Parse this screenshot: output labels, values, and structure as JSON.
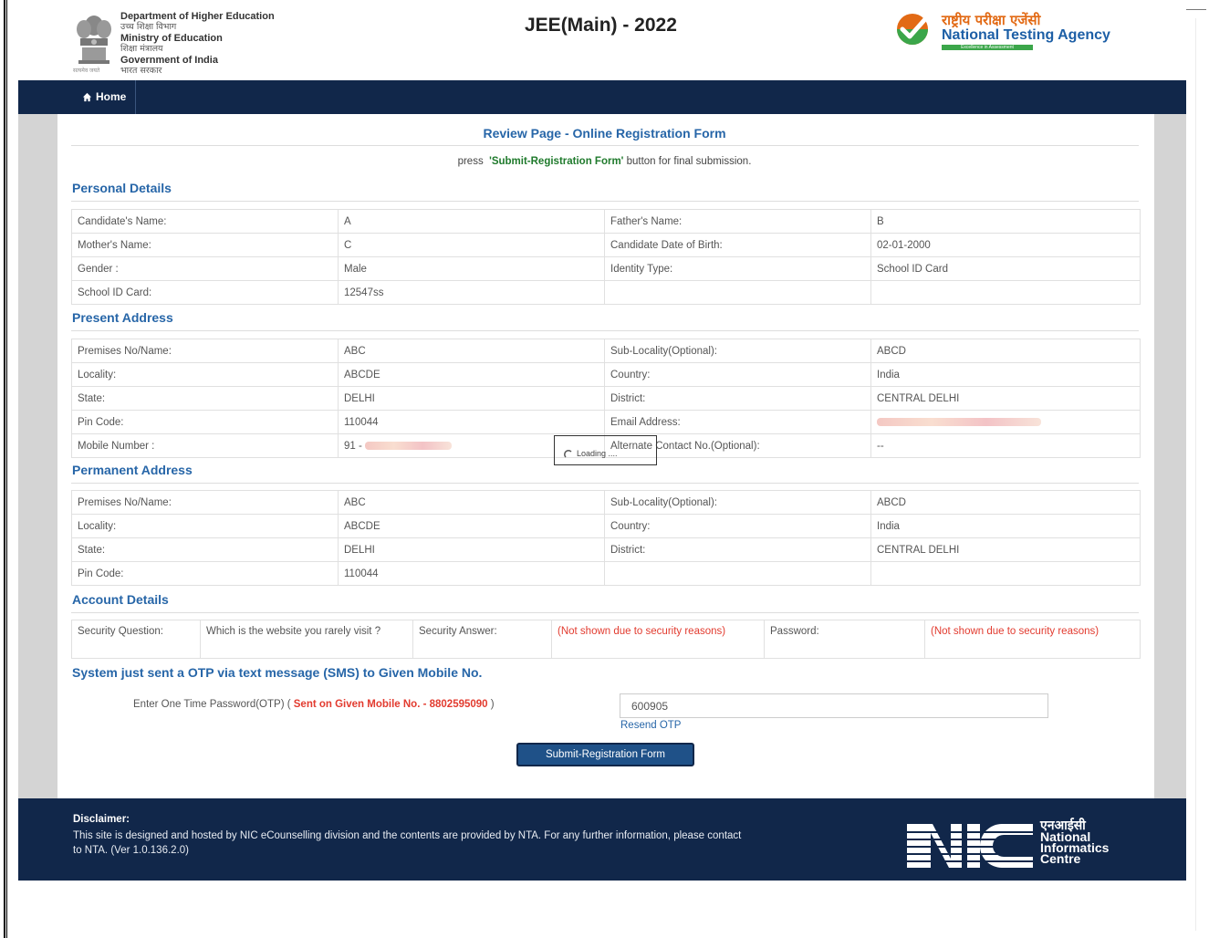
{
  "header": {
    "dept_lines": [
      "Department of Higher Education",
      "उच्च शिक्षा विभाग",
      "Ministry of Education",
      "शिक्षा मंत्रालय",
      "Government of India",
      "भारत सरकार"
    ],
    "emblem_caption": "सत्यमेव जयते",
    "exam_title": "JEE(Main) - 2022",
    "agency_hindi": "राष्ट्रीय परीक्षा एजेंसी",
    "agency_english": "National Testing Agency",
    "agency_tagline": "Excellence in Assessment"
  },
  "nav": {
    "home_label": "Home"
  },
  "page": {
    "title": "Review Page - Online Registration Form",
    "note_prefix": "press",
    "note_button": "'Submit-Registration Form'",
    "note_suffix": "button for final submission."
  },
  "personal": {
    "heading": "Personal Details",
    "rows": [
      [
        "Candidate's Name:",
        "A",
        "Father's Name:",
        "B"
      ],
      [
        "Mother's Name:",
        "C",
        "Candidate Date of Birth:",
        "02-01-2000"
      ],
      [
        "Gender :",
        "Male",
        "Identity Type:",
        "School ID Card"
      ],
      [
        "School ID Card:",
        "12547ss",
        "",
        ""
      ]
    ]
  },
  "present": {
    "heading": "Present Address",
    "rows": [
      [
        "Premises No/Name:",
        "ABC",
        "Sub-Locality(Optional):",
        "ABCD"
      ],
      [
        "Locality:",
        "ABCDE",
        "Country:",
        "India"
      ],
      [
        "State:",
        "DELHI",
        "District:",
        "CENTRAL DELHI"
      ],
      [
        "Pin Code:",
        "110044",
        "Email Address:",
        ""
      ],
      [
        "Mobile Number :",
        "91 - ",
        "Alternate Contact No.(Optional):",
        "--"
      ]
    ]
  },
  "permanent": {
    "heading": "Permanent Address",
    "rows": [
      [
        "Premises No/Name:",
        "ABC",
        "Sub-Locality(Optional):",
        "ABCD"
      ],
      [
        "Locality:",
        "ABCDE",
        "Country:",
        "India"
      ],
      [
        "State:",
        "DELHI",
        "District:",
        "CENTRAL DELHI"
      ],
      [
        "Pin Code:",
        "110044",
        "",
        ""
      ]
    ]
  },
  "account": {
    "heading": "Account Details",
    "security_question_label": "Security Question:",
    "security_question_value": "Which is the website you rarely visit ?",
    "security_answer_label": "Security Answer:",
    "security_answer_value": "(Not shown due to security reasons)",
    "password_label": "Password:",
    "password_value": "(Not shown due to security reasons)"
  },
  "otp": {
    "heading": "System just sent a OTP via text message (SMS) to Given Mobile No.",
    "label_prefix": "Enter One Time Password(OTP) (",
    "label_sent": "Sent on Given Mobile No. - 8802595090",
    "label_suffix": ")",
    "value": "600905",
    "resend": "Resend OTP",
    "submit": "Submit-Registration Form"
  },
  "loading": {
    "text": "Loading ...."
  },
  "footer": {
    "title": "Disclaimer:",
    "text": "This site is designed and hosted by NIC eCounselling division and the contents are provided by NTA. For any further information, please contact to NTA. (Ver 1.0.136.2.0)",
    "nic_hindi": "एनआईसी",
    "nic_lines": [
      "National",
      "Informatics",
      "Centre"
    ]
  },
  "colors": {
    "navy": "#11274a",
    "link_blue": "#2766a8",
    "alert_red": "#e23b2f",
    "note_green": "#1f7a2c",
    "nta_orange": "#e26a15"
  }
}
